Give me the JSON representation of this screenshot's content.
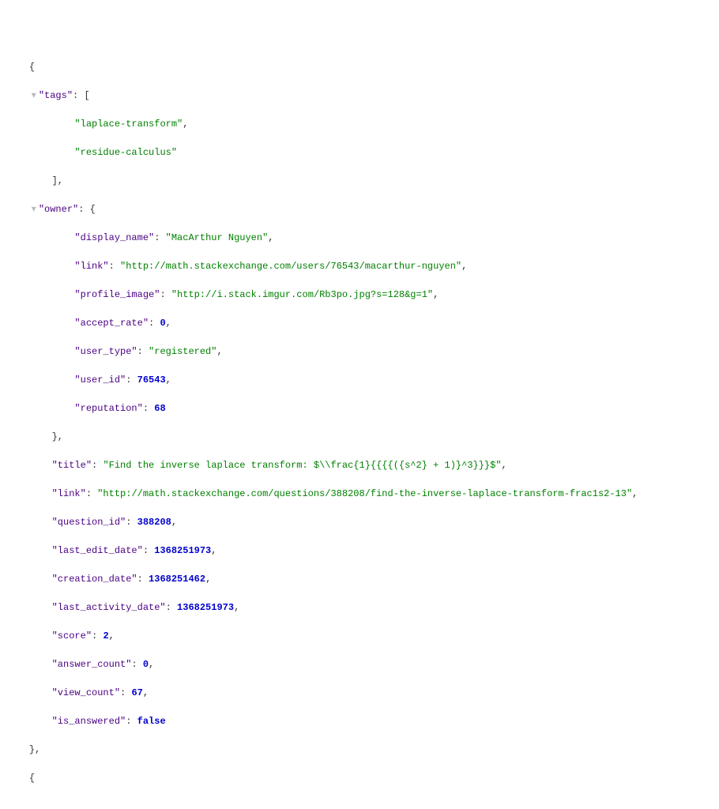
{
  "indent": {
    "i0": "",
    "i1": "    ",
    "i2": "        ",
    "i3": "            "
  },
  "toggle": "▾",
  "punct": {
    "lbrace": "{",
    "rbrace": "}",
    "lbracket": "[",
    "rbracket": "]",
    "comma": ",",
    "colon": ": ",
    "rbrace_comma": "},",
    "rbracket_comma": "],"
  },
  "keys": {
    "tags": "\"tags\"",
    "owner": "\"owner\"",
    "display_name": "\"display_name\"",
    "link": "\"link\"",
    "profile_image": "\"profile_image\"",
    "accept_rate": "\"accept_rate\"",
    "user_type": "\"user_type\"",
    "user_id": "\"user_id\"",
    "reputation": "\"reputation\"",
    "title": "\"title\"",
    "question_id": "\"question_id\"",
    "last_edit_date": "\"last_edit_date\"",
    "creation_date": "\"creation_date\"",
    "last_activity_date": "\"last_activity_date\"",
    "score": "\"score\"",
    "answer_count": "\"answer_count\"",
    "view_count": "\"view_count\"",
    "is_answered": "\"is_answered\""
  },
  "vals": {
    "tag0": "\"laplace-transform\"",
    "tag1": "\"residue-calculus\"",
    "display_name": "\"MacArthur Nguyen\"",
    "owner_link": "\"http://math.stackexchange.com/users/76543/macarthur-nguyen\"",
    "profile_image": "\"http://i.stack.imgur.com/Rb3po.jpg?s=128&g=1\"",
    "accept_rate": "0",
    "user_type": "\"registered\"",
    "user_id": "76543",
    "reputation": "68",
    "title": "\"Find the inverse laplace transform: $\\\\frac{1}{{{{({s^2} + 1)}^3}}}$\"",
    "link": "\"http://math.stackexchange.com/questions/388208/find-the-inverse-laplace-transform-frac1s2-13\"",
    "question_id": "388208",
    "last_edit_date": "1368251973",
    "creation_date": "1368251462",
    "last_activity_date": "1368251973",
    "score": "2",
    "answer_count": "0",
    "view_count": "67",
    "is_answered": "false"
  }
}
